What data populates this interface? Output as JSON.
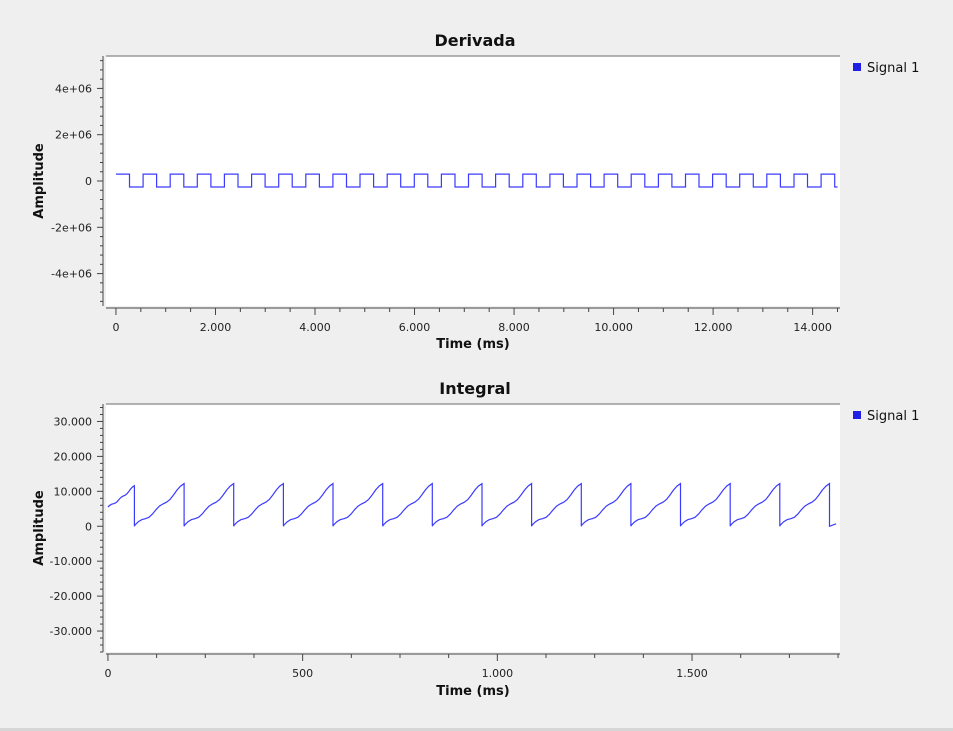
{
  "chart_data": [
    {
      "type": "line",
      "title": "Derivada",
      "xlabel": "Time (ms)",
      "ylabel": "Amplitude",
      "xlim": [
        -0.2,
        14.55
      ],
      "ylim": [
        -5400000,
        5400000
      ],
      "xticks": [
        0,
        2,
        4,
        6,
        8,
        10,
        12,
        14
      ],
      "xtick_labels": [
        "0",
        "2.000",
        "4.000",
        "6.000",
        "8.000",
        "10.000",
        "12.000",
        "14.000"
      ],
      "yticks": [
        4000000,
        2000000,
        0,
        -2000000,
        -4000000
      ],
      "ytick_labels": [
        "4e+06",
        "2e+06",
        "0",
        "-2e+06",
        "-4e+06"
      ],
      "legend": {
        "position": "right-outside-top",
        "entries": [
          "Signal 1"
        ]
      },
      "grid": false,
      "series": [
        {
          "name": "Signal 1",
          "color": "#3b3bff",
          "waveform": "square",
          "period": 0.545,
          "duty": 0.5,
          "high": 300000,
          "low": -260000,
          "x_start": 0,
          "x_end": 14.5
        }
      ]
    },
    {
      "type": "line",
      "title": "Integral",
      "xlabel": "Time (ms)",
      "ylabel": "Amplitude",
      "xlim": [
        -5,
        1880
      ],
      "ylim": [
        -36000,
        35000
      ],
      "xticks": [
        0,
        500,
        1000,
        1500
      ],
      "xtick_labels": [
        "0",
        "500",
        "1.000",
        "1.500"
      ],
      "yticks": [
        30000,
        20000,
        10000,
        0,
        -10000,
        -20000,
        -30000
      ],
      "ytick_labels": [
        "30.000",
        "20.000",
        "10.000",
        "0",
        "-10.000",
        "-20.000",
        "-30.000"
      ],
      "legend": {
        "position": "right-outside-top",
        "entries": [
          "Signal 1"
        ]
      },
      "grid": false,
      "series": [
        {
          "name": "Signal 1",
          "color": "#3b3bff",
          "waveform": "sawtooth",
          "period": 127.5,
          "min": 0,
          "max": 12200,
          "first_value": 5500,
          "first_drop": 68,
          "x_start": 0,
          "x_end": 1870,
          "end_value": 700
        }
      ]
    }
  ]
}
